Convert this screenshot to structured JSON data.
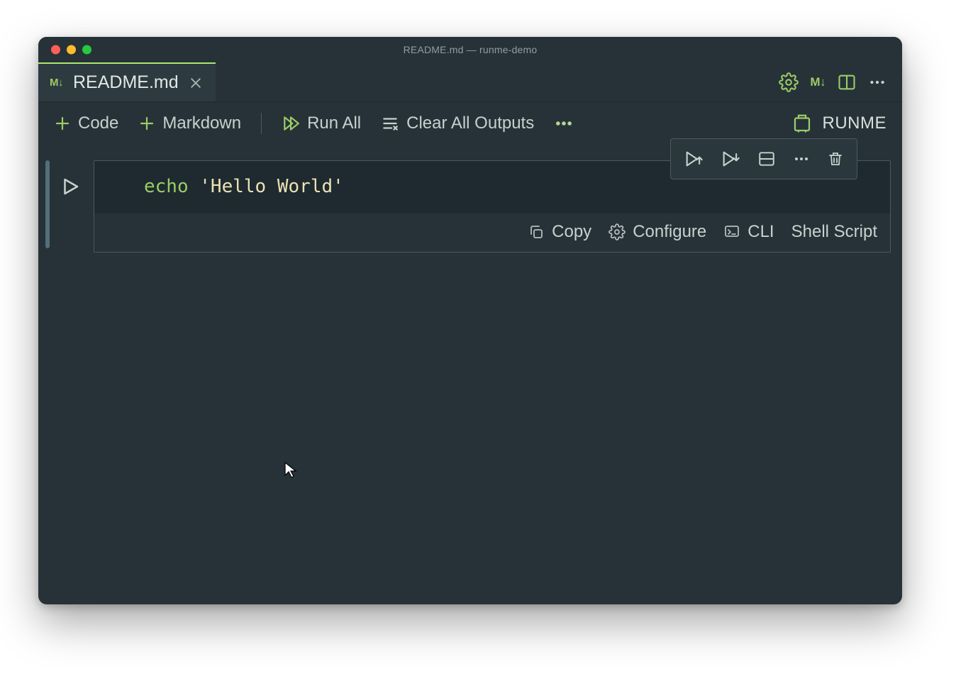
{
  "window": {
    "title": "README.md — runme-demo"
  },
  "tab": {
    "filetype_badge": "M↓",
    "filename": "README.md"
  },
  "toolbar": {
    "code_label": "Code",
    "markdown_label": "Markdown",
    "run_all_label": "Run All",
    "clear_all_label": "Clear All Outputs",
    "runme_label": "RUNME"
  },
  "cell": {
    "code_command": "echo",
    "code_after_command": " ",
    "code_string": "'Hello World'",
    "footer": {
      "copy_label": "Copy",
      "configure_label": "Configure",
      "cli_label": "CLI",
      "language_label": "Shell Script"
    }
  },
  "tab_actions": {
    "markdown_badge": "M↓"
  }
}
